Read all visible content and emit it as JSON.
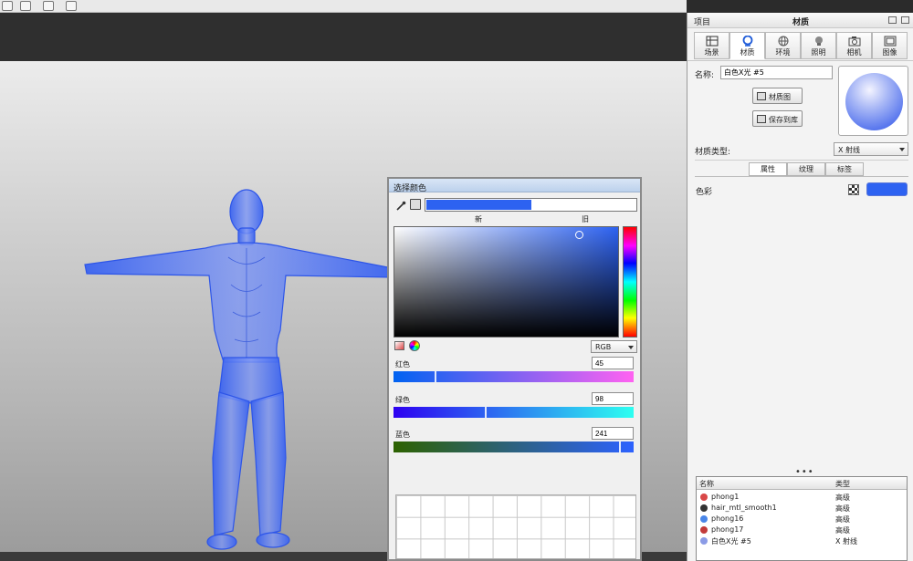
{
  "panel": {
    "project_label": "项目",
    "title": "材质",
    "tabs": [
      {
        "label": "场景",
        "icon": "scene-icon"
      },
      {
        "label": "材质",
        "icon": "material-icon"
      },
      {
        "label": "环境",
        "icon": "globe-icon"
      },
      {
        "label": "照明",
        "icon": "light-icon"
      },
      {
        "label": "相机",
        "icon": "camera-icon"
      },
      {
        "label": "图像",
        "icon": "image-icon"
      }
    ],
    "active_tab": "材质",
    "name_label": "名称:",
    "name_value": "白色X光 #5",
    "material_graph_button": "材质图",
    "save_to_library_button": "保存到库",
    "material_type_label": "材质类型:",
    "material_type_value": "X 射线",
    "subtabs": [
      "属性",
      "纹理",
      "标签"
    ],
    "active_subtab": "属性",
    "color_label": "色彩",
    "color_value": "#2d62f1"
  },
  "library": {
    "columns": [
      "名称",
      "类型"
    ],
    "rows": [
      {
        "name": "phong1",
        "type": "高级",
        "color": "#d94848"
      },
      {
        "name": "hair_mtl_smooth1",
        "type": "高级",
        "color": "#333333"
      },
      {
        "name": "phong16",
        "type": "高级",
        "color": "#4a86e8"
      },
      {
        "name": "phong17",
        "type": "高级",
        "color": "#c23b3b"
      },
      {
        "name": "白色X光 #5",
        "type": "X 射线",
        "color": "#8b9be6"
      }
    ]
  },
  "color_picker": {
    "title": "选择颜色",
    "new_label": "新",
    "old_label": "旧",
    "new_color": "#2d62f1",
    "old_color": "#ffffff",
    "mode": "RGB",
    "channels": [
      {
        "label": "红色",
        "value": "45"
      },
      {
        "label": "绿色",
        "value": "98"
      },
      {
        "label": "蓝色",
        "value": "241"
      }
    ]
  }
}
